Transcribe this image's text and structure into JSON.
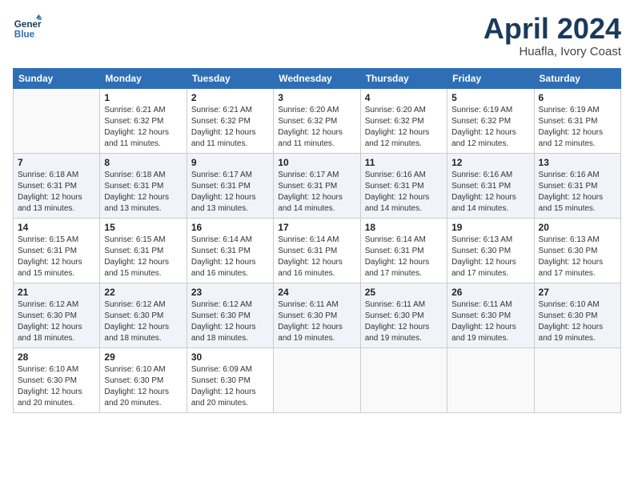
{
  "logo": {
    "line1": "General",
    "line2": "Blue"
  },
  "title": "April 2024",
  "location": "Huafla, Ivory Coast",
  "weekdays": [
    "Sunday",
    "Monday",
    "Tuesday",
    "Wednesday",
    "Thursday",
    "Friday",
    "Saturday"
  ],
  "weeks": [
    [
      {
        "day": "",
        "sunrise": "",
        "sunset": "",
        "daylight": ""
      },
      {
        "day": "1",
        "sunrise": "Sunrise: 6:21 AM",
        "sunset": "Sunset: 6:32 PM",
        "daylight": "Daylight: 12 hours and 11 minutes."
      },
      {
        "day": "2",
        "sunrise": "Sunrise: 6:21 AM",
        "sunset": "Sunset: 6:32 PM",
        "daylight": "Daylight: 12 hours and 11 minutes."
      },
      {
        "day": "3",
        "sunrise": "Sunrise: 6:20 AM",
        "sunset": "Sunset: 6:32 PM",
        "daylight": "Daylight: 12 hours and 11 minutes."
      },
      {
        "day": "4",
        "sunrise": "Sunrise: 6:20 AM",
        "sunset": "Sunset: 6:32 PM",
        "daylight": "Daylight: 12 hours and 12 minutes."
      },
      {
        "day": "5",
        "sunrise": "Sunrise: 6:19 AM",
        "sunset": "Sunset: 6:32 PM",
        "daylight": "Daylight: 12 hours and 12 minutes."
      },
      {
        "day": "6",
        "sunrise": "Sunrise: 6:19 AM",
        "sunset": "Sunset: 6:31 PM",
        "daylight": "Daylight: 12 hours and 12 minutes."
      }
    ],
    [
      {
        "day": "7",
        "sunrise": "Sunrise: 6:18 AM",
        "sunset": "Sunset: 6:31 PM",
        "daylight": "Daylight: 12 hours and 13 minutes."
      },
      {
        "day": "8",
        "sunrise": "Sunrise: 6:18 AM",
        "sunset": "Sunset: 6:31 PM",
        "daylight": "Daylight: 12 hours and 13 minutes."
      },
      {
        "day": "9",
        "sunrise": "Sunrise: 6:17 AM",
        "sunset": "Sunset: 6:31 PM",
        "daylight": "Daylight: 12 hours and 13 minutes."
      },
      {
        "day": "10",
        "sunrise": "Sunrise: 6:17 AM",
        "sunset": "Sunset: 6:31 PM",
        "daylight": "Daylight: 12 hours and 14 minutes."
      },
      {
        "day": "11",
        "sunrise": "Sunrise: 6:16 AM",
        "sunset": "Sunset: 6:31 PM",
        "daylight": "Daylight: 12 hours and 14 minutes."
      },
      {
        "day": "12",
        "sunrise": "Sunrise: 6:16 AM",
        "sunset": "Sunset: 6:31 PM",
        "daylight": "Daylight: 12 hours and 14 minutes."
      },
      {
        "day": "13",
        "sunrise": "Sunrise: 6:16 AM",
        "sunset": "Sunset: 6:31 PM",
        "daylight": "Daylight: 12 hours and 15 minutes."
      }
    ],
    [
      {
        "day": "14",
        "sunrise": "Sunrise: 6:15 AM",
        "sunset": "Sunset: 6:31 PM",
        "daylight": "Daylight: 12 hours and 15 minutes."
      },
      {
        "day": "15",
        "sunrise": "Sunrise: 6:15 AM",
        "sunset": "Sunset: 6:31 PM",
        "daylight": "Daylight: 12 hours and 15 minutes."
      },
      {
        "day": "16",
        "sunrise": "Sunrise: 6:14 AM",
        "sunset": "Sunset: 6:31 PM",
        "daylight": "Daylight: 12 hours and 16 minutes."
      },
      {
        "day": "17",
        "sunrise": "Sunrise: 6:14 AM",
        "sunset": "Sunset: 6:31 PM",
        "daylight": "Daylight: 12 hours and 16 minutes."
      },
      {
        "day": "18",
        "sunrise": "Sunrise: 6:14 AM",
        "sunset": "Sunset: 6:31 PM",
        "daylight": "Daylight: 12 hours and 17 minutes."
      },
      {
        "day": "19",
        "sunrise": "Sunrise: 6:13 AM",
        "sunset": "Sunset: 6:30 PM",
        "daylight": "Daylight: 12 hours and 17 minutes."
      },
      {
        "day": "20",
        "sunrise": "Sunrise: 6:13 AM",
        "sunset": "Sunset: 6:30 PM",
        "daylight": "Daylight: 12 hours and 17 minutes."
      }
    ],
    [
      {
        "day": "21",
        "sunrise": "Sunrise: 6:12 AM",
        "sunset": "Sunset: 6:30 PM",
        "daylight": "Daylight: 12 hours and 18 minutes."
      },
      {
        "day": "22",
        "sunrise": "Sunrise: 6:12 AM",
        "sunset": "Sunset: 6:30 PM",
        "daylight": "Daylight: 12 hours and 18 minutes."
      },
      {
        "day": "23",
        "sunrise": "Sunrise: 6:12 AM",
        "sunset": "Sunset: 6:30 PM",
        "daylight": "Daylight: 12 hours and 18 minutes."
      },
      {
        "day": "24",
        "sunrise": "Sunrise: 6:11 AM",
        "sunset": "Sunset: 6:30 PM",
        "daylight": "Daylight: 12 hours and 19 minutes."
      },
      {
        "day": "25",
        "sunrise": "Sunrise: 6:11 AM",
        "sunset": "Sunset: 6:30 PM",
        "daylight": "Daylight: 12 hours and 19 minutes."
      },
      {
        "day": "26",
        "sunrise": "Sunrise: 6:11 AM",
        "sunset": "Sunset: 6:30 PM",
        "daylight": "Daylight: 12 hours and 19 minutes."
      },
      {
        "day": "27",
        "sunrise": "Sunrise: 6:10 AM",
        "sunset": "Sunset: 6:30 PM",
        "daylight": "Daylight: 12 hours and 19 minutes."
      }
    ],
    [
      {
        "day": "28",
        "sunrise": "Sunrise: 6:10 AM",
        "sunset": "Sunset: 6:30 PM",
        "daylight": "Daylight: 12 hours and 20 minutes."
      },
      {
        "day": "29",
        "sunrise": "Sunrise: 6:10 AM",
        "sunset": "Sunset: 6:30 PM",
        "daylight": "Daylight: 12 hours and 20 minutes."
      },
      {
        "day": "30",
        "sunrise": "Sunrise: 6:09 AM",
        "sunset": "Sunset: 6:30 PM",
        "daylight": "Daylight: 12 hours and 20 minutes."
      },
      {
        "day": "",
        "sunrise": "",
        "sunset": "",
        "daylight": ""
      },
      {
        "day": "",
        "sunrise": "",
        "sunset": "",
        "daylight": ""
      },
      {
        "day": "",
        "sunrise": "",
        "sunset": "",
        "daylight": ""
      },
      {
        "day": "",
        "sunrise": "",
        "sunset": "",
        "daylight": ""
      }
    ]
  ]
}
